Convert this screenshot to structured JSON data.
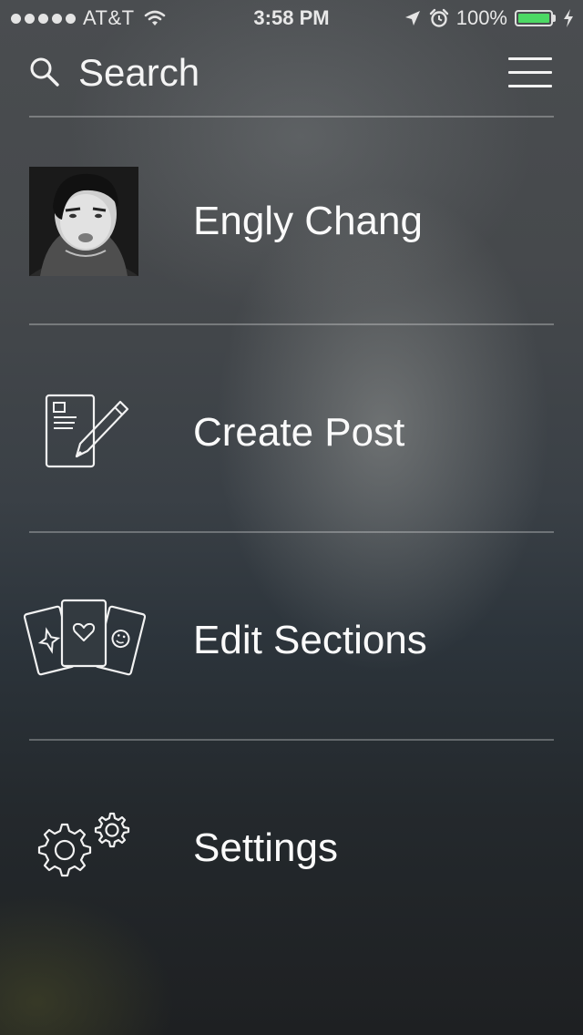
{
  "status_bar": {
    "carrier": "AT&T",
    "time": "3:58 PM",
    "battery": "100%",
    "battery_level": 1.0,
    "battery_color": "#4cd964",
    "icons": [
      "signal-dots-icon",
      "wifi-icon",
      "location-arrow-icon",
      "alarm-icon",
      "battery-icon",
      "charging-bolt-icon"
    ]
  },
  "header": {
    "search_label": "Search",
    "search_icon": "search-icon",
    "menu_icon": "hamburger-menu-icon"
  },
  "menu": {
    "items": [
      {
        "label": "Engly Chang",
        "icon": "profile-avatar"
      },
      {
        "label": "Create Post",
        "icon": "create-post-icon"
      },
      {
        "label": "Edit Sections",
        "icon": "edit-sections-cards-icon"
      },
      {
        "label": "Settings",
        "icon": "settings-gears-icon"
      }
    ]
  }
}
